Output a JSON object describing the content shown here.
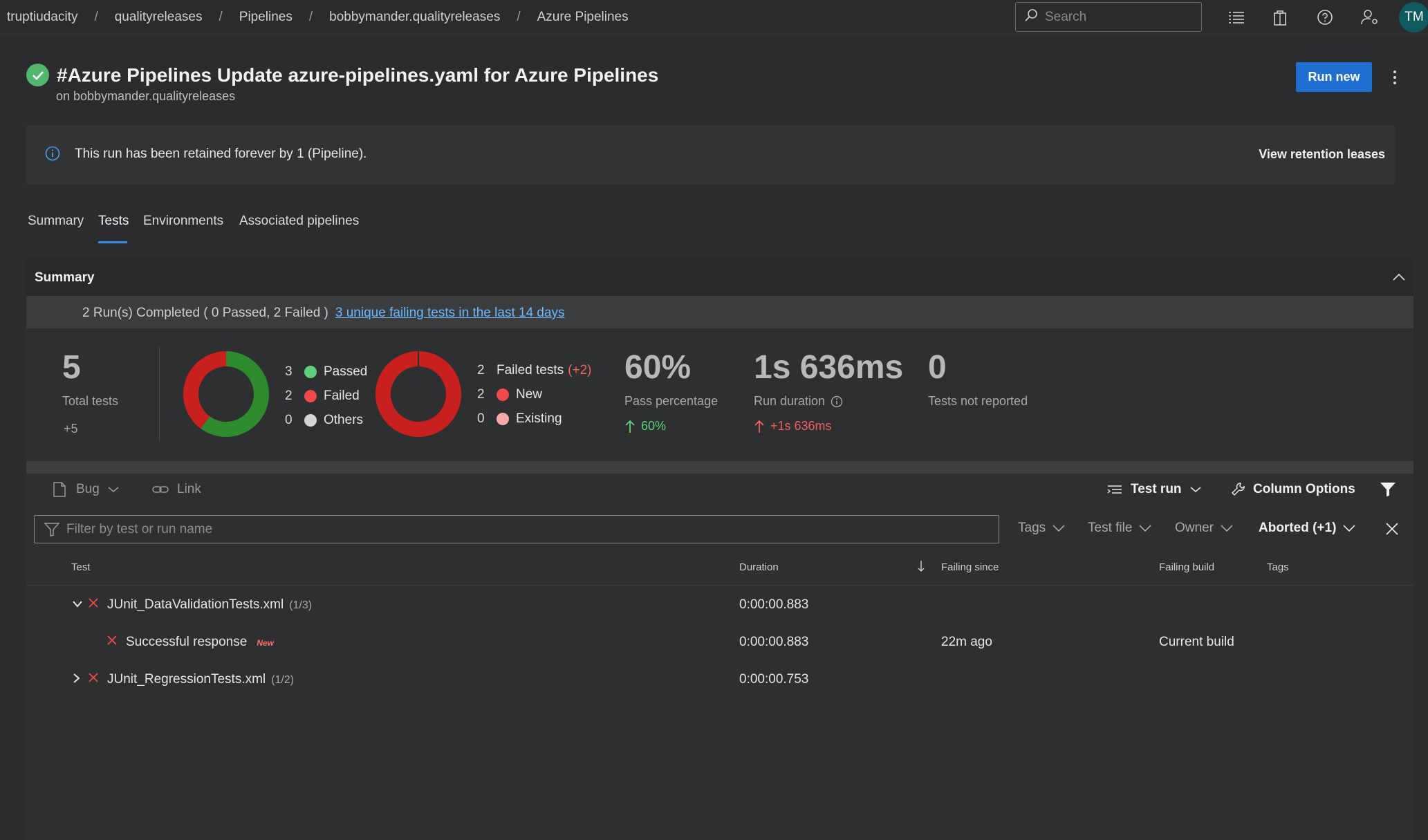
{
  "breadcrumb": [
    "truptiudacity",
    "qualityreleases",
    "Pipelines",
    "bobbymander.qualityreleases",
    "Azure Pipelines"
  ],
  "header": {
    "search_placeholder": "Search",
    "avatar_initials": "TM"
  },
  "run": {
    "title": "#Azure Pipelines Update azure-pipelines.yaml for Azure Pipelines",
    "subtitle": "on bobbymander.qualityreleases",
    "run_new_label": "Run new"
  },
  "banner": {
    "text": "This run has been retained forever by 1 (Pipeline).",
    "action_label": "View retention leases"
  },
  "tabs": [
    {
      "label": "Summary",
      "active": false
    },
    {
      "label": "Tests",
      "active": true
    },
    {
      "label": "Environments",
      "active": false
    },
    {
      "label": "Associated pipelines",
      "active": false
    }
  ],
  "summary": {
    "title": "Summary",
    "runs_text": "2 Run(s) Completed ( 0 Passed, 2 Failed )",
    "failing_link": "3 unique failing tests in the last 14 days",
    "total": {
      "value": "5",
      "label": "Total tests",
      "delta": "+5"
    },
    "outcome_legend": [
      {
        "count": "3",
        "label": "Passed",
        "color": "#5fd07a",
        "value": 3
      },
      {
        "count": "2",
        "label": "Failed",
        "color": "#f04a4a",
        "value": 2
      },
      {
        "count": "0",
        "label": "Others",
        "color": "#d4d4d4",
        "value": 0
      }
    ],
    "failed_legend": {
      "title": "Failed tests",
      "delta": "(+2)",
      "count": "2",
      "items": [
        {
          "count": "2",
          "label": "New",
          "color": "#f04a4a",
          "value": 2
        },
        {
          "count": "0",
          "label": "Existing",
          "color": "#f7a8a8",
          "value": 0
        }
      ]
    },
    "pass_pct": {
      "value": "60%",
      "label": "Pass percentage",
      "delta": "60%"
    },
    "duration": {
      "value": "1s 636ms",
      "label": "Run duration",
      "delta": "+1s 636ms"
    },
    "not_reported": {
      "value": "0",
      "label": "Tests not reported"
    },
    "colors": {
      "passed_donut": "#2e8b2e",
      "failed_donut": "#c8201f",
      "up_green": "#5fd07a",
      "up_red": "#f06060"
    }
  },
  "toolbar": {
    "bug": "Bug",
    "link": "Link",
    "test_run": "Test run",
    "column_options": "Column Options"
  },
  "filter": {
    "placeholder": "Filter by test or run name",
    "tags": "Tags",
    "test_file": "Test file",
    "owner": "Owner",
    "outcome": "Aborted (+1)"
  },
  "table": {
    "columns": {
      "test": "Test",
      "duration": "Duration",
      "failing_since": "Failing since",
      "failing_build": "Failing build",
      "tags": "Tags"
    },
    "rows": [
      {
        "name": "JUnit_DataValidationTests.xml",
        "count": "(1/3)",
        "duration": "0:00:00.883",
        "failing_since": "",
        "failing_build": "",
        "badge": ""
      },
      {
        "name": "Successful response",
        "count": "",
        "duration": "0:00:00.883",
        "failing_since": "22m ago",
        "failing_build": "Current build",
        "badge": "New"
      },
      {
        "name": "JUnit_RegressionTests.xml",
        "count": "(1/2)",
        "duration": "0:00:00.753",
        "failing_since": "",
        "failing_build": "",
        "badge": ""
      }
    ]
  }
}
